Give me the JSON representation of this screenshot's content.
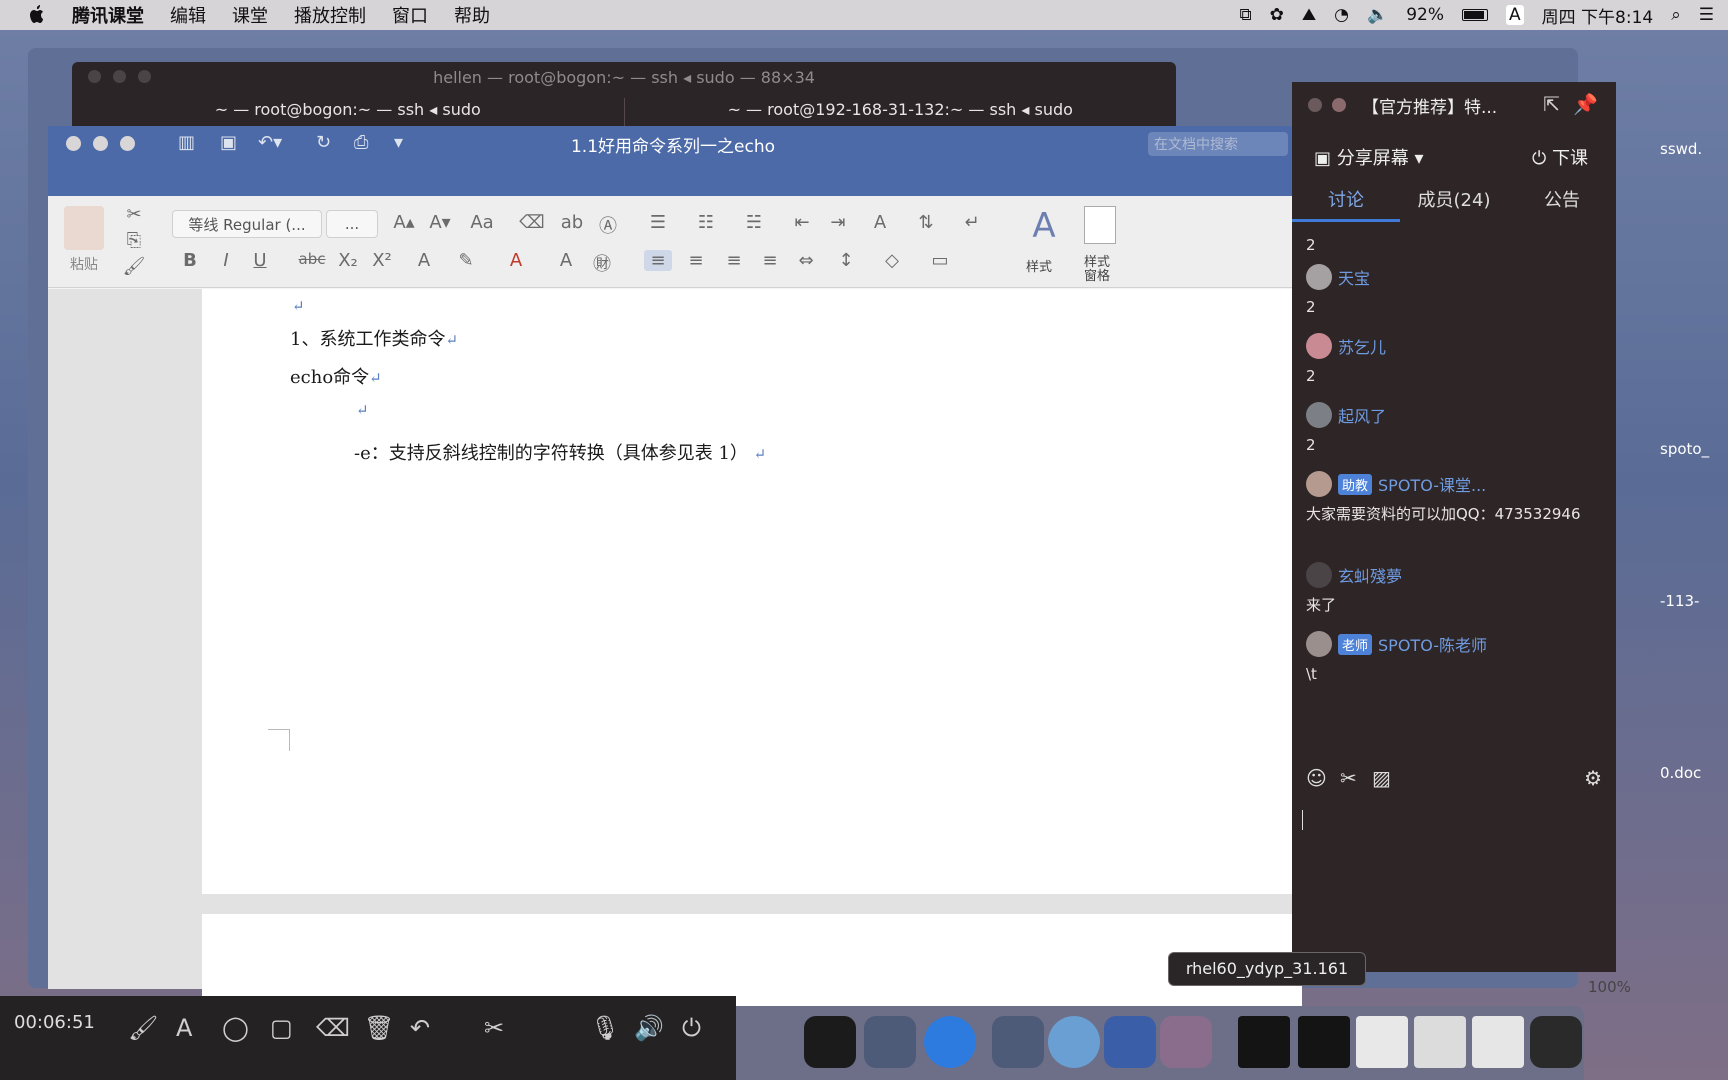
{
  "menubar": {
    "app": "腾讯课堂",
    "items": [
      "编辑",
      "课堂",
      "播放控制",
      "窗口",
      "帮助"
    ],
    "battery": "92%",
    "input_method": "A",
    "clock": "周四 下午8:14"
  },
  "terminal": {
    "title": "hellen — root@bogon:~ — ssh ◂ sudo — 88×34",
    "tabs": [
      "~ — root@bogon:~ — ssh ◂ sudo",
      "~ — root@192-168-31-132:~ — ssh ◂ sudo"
    ]
  },
  "word": {
    "title": "1.1好用命令系列一之echo",
    "search_placeholder": "在文档中搜索",
    "ribbon": {
      "paste": "粘贴",
      "font_name": "等线 Regular (...",
      "font_size": "...",
      "styles": "样式",
      "styles_pane": "样式\n窗格"
    },
    "doc": {
      "heading": "1、系统工作类命令",
      "subheading": "echo命令",
      "option_line": "-e：支持反斜线控制的字符转换（具体参见表 1）"
    },
    "zoom": "100%"
  },
  "chat": {
    "title": "【官方推荐】特...",
    "share_screen": "分享屏幕",
    "end_class": "下课",
    "tabs": [
      "讨论",
      "成员(24)",
      "公告"
    ],
    "messages": [
      {
        "name": "",
        "tag": "",
        "body": "2"
      },
      {
        "name": "天宝",
        "tag": "",
        "body": "2"
      },
      {
        "name": "苏乞儿",
        "tag": "",
        "body": "2"
      },
      {
        "name": "起风了",
        "tag": "",
        "body": "2"
      },
      {
        "name": "SPOTO-课堂...",
        "tag": "助教",
        "body": "大家需要资料的可以加QQ：473532946"
      },
      {
        "name": "玄虯殘夢",
        "tag": "",
        "body": "来了"
      },
      {
        "name": "SPOTO-陈老师",
        "tag": "老师",
        "body": "\\t"
      }
    ]
  },
  "tooltip": "rhel60_ydyp_31.161",
  "recorder": {
    "time": "00:06:51"
  },
  "desktop_labels": [
    "sswd.",
    "spoto_",
    "-113-",
    "0.doc"
  ]
}
